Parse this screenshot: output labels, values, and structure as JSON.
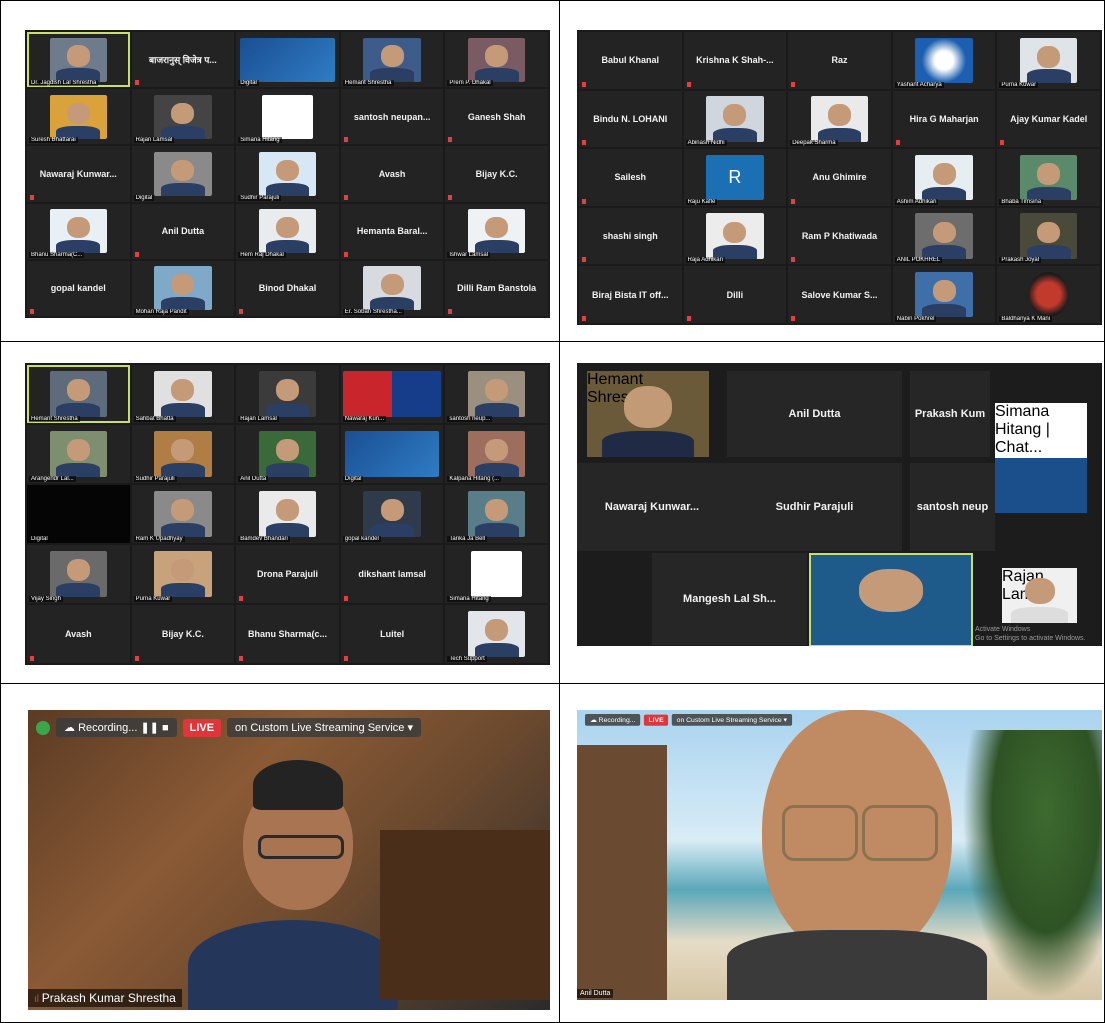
{
  "panel1": {
    "tiles": [
      {
        "type": "photo",
        "label": "Dr. Jagdish Lal Shrestha",
        "bg": "#6e7b8a",
        "hl": true
      },
      {
        "type": "name",
        "name": "बाजरानुस् विजेत्र प..."
      },
      {
        "type": "poster",
        "label": "Digital"
      },
      {
        "type": "photo",
        "label": "Hemant Shrestha",
        "bg": "#3e5c8a"
      },
      {
        "type": "photo",
        "label": "Prem P. Dhakal",
        "bg": "#7a5a63"
      },
      {
        "type": "photo",
        "label": "Suresh Bhattarai",
        "bg": "#d9a23a"
      },
      {
        "type": "photo",
        "label": "Rajan Lamsal",
        "bg": "#444"
      },
      {
        "type": "logo",
        "label": "Simana Hitang"
      },
      {
        "type": "name",
        "name": "santosh neupan..."
      },
      {
        "type": "name",
        "name": "Ganesh Shah"
      },
      {
        "type": "name",
        "name": "Nawaraj Kunwar..."
      },
      {
        "type": "photo",
        "label": "Digital",
        "bg": "#8a8a8a"
      },
      {
        "type": "photo",
        "label": "Sudhir Parajuli",
        "bg": "#d8e7f4"
      },
      {
        "type": "name",
        "name": "Avash"
      },
      {
        "type": "name",
        "name": "Bijay K.C."
      },
      {
        "type": "photo",
        "label": "Bhanu Sharma(C...",
        "bg": "#e9f0f5"
      },
      {
        "type": "name",
        "name": "Anil Dutta"
      },
      {
        "type": "photo",
        "label": "Hem Raj Dhakal",
        "bg": "#e9ecef"
      },
      {
        "type": "name",
        "name": "Hemanta Baral..."
      },
      {
        "type": "photo",
        "label": "Ishwar Lamsal",
        "bg": "#eef2f4"
      },
      {
        "type": "name",
        "name": "gopal kandel"
      },
      {
        "type": "photo",
        "label": "Mohan Raja Pandit",
        "bg": "#7fa9c9"
      },
      {
        "type": "name",
        "name": "Binod Dhakal"
      },
      {
        "type": "photo",
        "label": "Er. Soban Shrestha...",
        "bg": "#d7dbe0"
      },
      {
        "type": "name",
        "name": "Dilli Ram Banstola"
      }
    ]
  },
  "panel2": {
    "tiles": [
      {
        "type": "name",
        "name": "Babul Khanal"
      },
      {
        "type": "name",
        "name": "Krishna K Shah-..."
      },
      {
        "type": "name",
        "name": "Raz"
      },
      {
        "type": "logo2",
        "label": "Yashant Acharya"
      },
      {
        "type": "photo",
        "label": "Purna Kuwar",
        "bg": "#dfe4e8"
      },
      {
        "type": "name",
        "name": "Bindu N. LOHANI"
      },
      {
        "type": "photo",
        "label": "Abinash Nidhi",
        "bg": "#cfd6de"
      },
      {
        "type": "photo",
        "label": "Deepak Sharma",
        "bg": "#eaeaea"
      },
      {
        "type": "name",
        "name": "Hira G Maharjan"
      },
      {
        "type": "name",
        "name": "Ajay Kumar Kadel"
      },
      {
        "type": "name",
        "name": "Sailesh"
      },
      {
        "type": "letter",
        "letter": "R",
        "label": "Raju Kafle"
      },
      {
        "type": "name",
        "name": "Anu Ghimire"
      },
      {
        "type": "photo",
        "label": "Ashim Adhikari",
        "bg": "#e7eef2"
      },
      {
        "type": "photo",
        "label": "Bhaba Timsina",
        "bg": "#5b8a6a"
      },
      {
        "type": "name",
        "name": "shashi singh"
      },
      {
        "type": "photo",
        "label": "Raja Adhikari",
        "bg": "#ececec"
      },
      {
        "type": "name",
        "name": "Ram P Khatiwada"
      },
      {
        "type": "photo",
        "label": "ANIL POKHREL",
        "bg": "#6d6d6d"
      },
      {
        "type": "photo",
        "label": "Prakash Joyal",
        "bg": "#4a4a3a"
      },
      {
        "type": "name",
        "name": "Biraj Bista IT off..."
      },
      {
        "type": "name",
        "name": "Dilli"
      },
      {
        "type": "name",
        "name": "Salove Kumar S..."
      },
      {
        "type": "photo",
        "label": "Nabin Pokhrel",
        "bg": "#3f6fa8"
      },
      {
        "type": "emblem",
        "label": "Baldhanya K Mani"
      }
    ]
  },
  "panel3": {
    "tiles": [
      {
        "type": "photo",
        "label": "Hemant Shrestha",
        "bg": "#5e6b7b",
        "hl": true
      },
      {
        "type": "photo",
        "label": "Sahbat Bhatta",
        "bg": "#e0e0e0"
      },
      {
        "type": "photo",
        "label": "Rajan Lamsal",
        "bg": "#3b3b3b"
      },
      {
        "type": "cn",
        "label": "Nawaraj Kun..."
      },
      {
        "type": "photo",
        "label": "santosh neup...",
        "bg": "#9b8f7f"
      },
      {
        "type": "photo",
        "label": "Arangendr Lal...",
        "bg": "#7d8f6e"
      },
      {
        "type": "photo",
        "label": "Sudhir Parajuli",
        "bg": "#b07d45"
      },
      {
        "type": "photo",
        "label": "Anil Dutta",
        "bg": "#3a6a3a"
      },
      {
        "type": "poster",
        "label": "Digital"
      },
      {
        "type": "photo",
        "label": "Kalpana Hitang (...",
        "bg": "#9d6d5d"
      },
      {
        "type": "black",
        "label": "Digital"
      },
      {
        "type": "photo",
        "label": "Ram K Upadhyay",
        "bg": "#8a8a8a"
      },
      {
        "type": "photo",
        "label": "Bamdev Bhandari",
        "bg": "#eaeaea"
      },
      {
        "type": "photo",
        "label": "gopal kandel",
        "bg": "#2f3b4a"
      },
      {
        "type": "photo",
        "label": "Tanka Ja Bell",
        "bg": "#5a7d8a"
      },
      {
        "type": "photo",
        "label": "Vijay Singh",
        "bg": "#6a6a6a"
      },
      {
        "type": "photo",
        "label": "Purna Kuwar",
        "bg": "#c7a27a"
      },
      {
        "type": "name",
        "name": "Drona Parajuli"
      },
      {
        "type": "name",
        "name": "dikshant lamsal"
      },
      {
        "type": "logo",
        "label": "Simana Hitang"
      },
      {
        "type": "name",
        "name": "Avash"
      },
      {
        "type": "name",
        "name": "Bijay K.C."
      },
      {
        "type": "name",
        "name": "Bhanu Sharma(c..."
      },
      {
        "type": "name",
        "name": "Luitel"
      },
      {
        "type": "photo",
        "label": "Tech Support",
        "bg": "#e2e6ea"
      }
    ]
  },
  "panel4": {
    "speaker_label": "Hemant Shrestha",
    "names": [
      "Anil Dutta",
      "Prakash Kum",
      "Nawaraj Kunwar...",
      "Sudhir Parajuli",
      "santosh neup",
      "Mangesh Lal Sh..."
    ],
    "side_labels": [
      "Simana Hitang | Chat...",
      "Digital",
      "Rajan Lamsal"
    ],
    "watermark": "Activate Windows",
    "watermark_sub": "Go to Settings to activate Windows."
  },
  "panel5": {
    "recording": "Recording...",
    "live": "LIVE",
    "service": "on Custom Live Streaming Service",
    "speaker": "Prakash Kumar Shrestha"
  },
  "panel6": {
    "recording": "Recording...",
    "live": "LIVE",
    "service": "on Custom Live Streaming Service",
    "speaker": "Anil Dutta"
  }
}
